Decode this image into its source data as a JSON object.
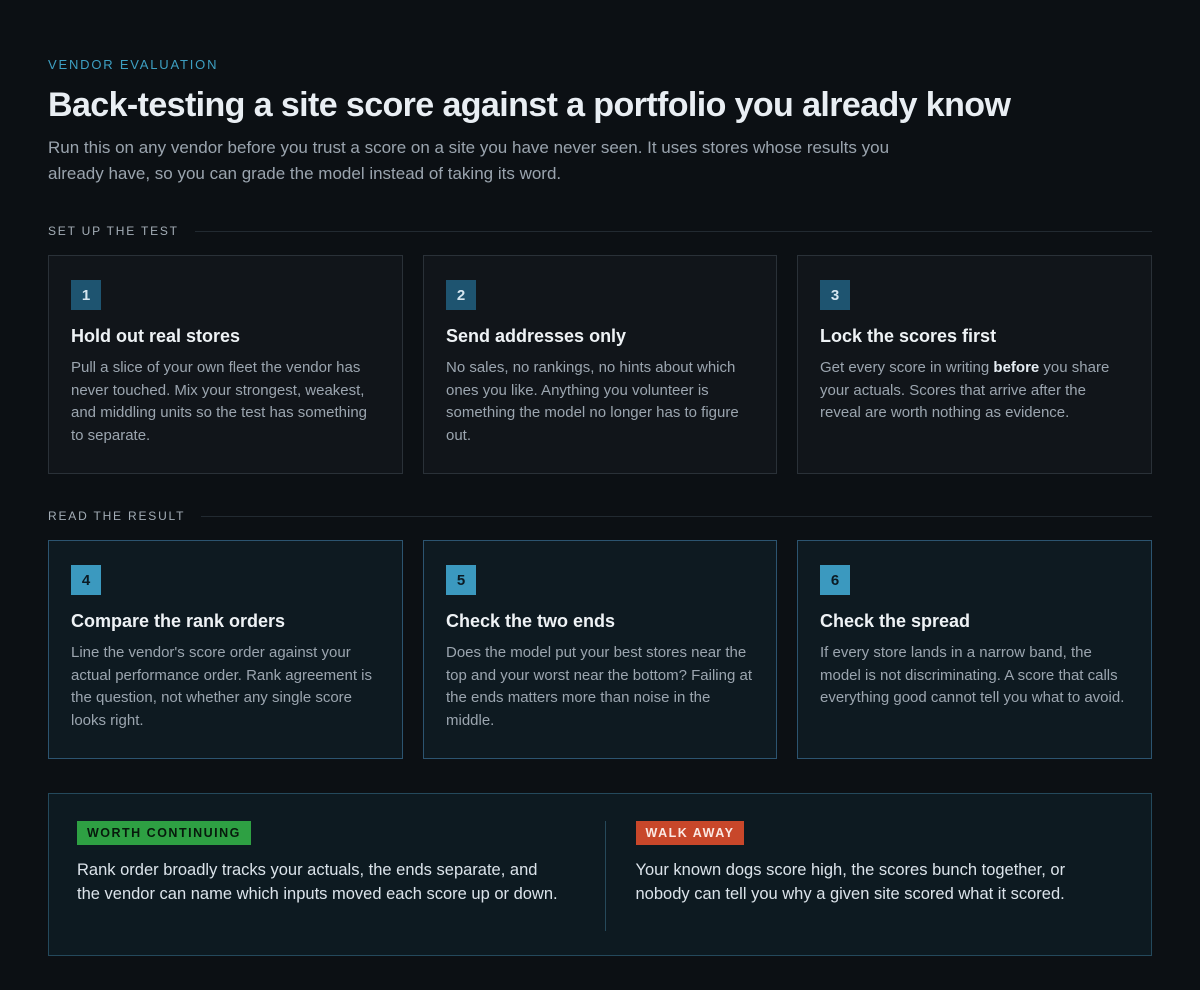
{
  "header": {
    "eyebrow": "VENDOR EVALUATION",
    "title": "Back-testing a site score against a portfolio you already know",
    "lede": "Run this on any vendor before you trust a score on a site you have never seen. It uses stores whose results you already have, so you can grade the model instead of taking its word."
  },
  "sections": [
    {
      "label": "SET UP THE TEST",
      "steps": [
        {
          "num": "1",
          "title": "Hold out real stores",
          "body": "Pull a slice of your own fleet the vendor has never touched. Mix your strongest, weakest, and middling units so the test has something to separate."
        },
        {
          "num": "2",
          "title": "Send addresses only",
          "body": "No sales, no rankings, no hints about which ones you like. Anything you volunteer is something the model no longer has to figure out."
        },
        {
          "num": "3",
          "title": "Lock the scores first",
          "body_before": "Get every score in writing ",
          "body_bold": "before",
          "body_after": " you share your actuals. Scores that arrive after the reveal are worth nothing as evidence."
        }
      ]
    },
    {
      "label": "READ THE RESULT",
      "steps": [
        {
          "num": "4",
          "title": "Compare the rank orders",
          "body": "Line the vendor's score order against your actual performance order. Rank agreement is the question, not whether any single score looks right."
        },
        {
          "num": "5",
          "title": "Check the two ends",
          "body": "Does the model put your best stores near the top and your worst near the bottom? Failing at the ends matters more than noise in the middle."
        },
        {
          "num": "6",
          "title": "Check the spread",
          "body": "If every store lands in a narrow band, the model is not discriminating. A score that calls everything good cannot tell you what to avoid."
        }
      ]
    }
  ],
  "verdict": {
    "continue": {
      "tag": "WORTH CONTINUING",
      "body": "Rank order broadly tracks your actuals, the ends separate, and the vendor can name which inputs moved each score up or down."
    },
    "walk": {
      "tag": "WALK AWAY",
      "body": "Your known dogs score high, the scores bunch together, or nobody can tell you why a given site scored what it scored."
    }
  },
  "colors": {
    "accent": "#3d9fc2",
    "go": "#2ea043",
    "stop": "#c8472a"
  }
}
